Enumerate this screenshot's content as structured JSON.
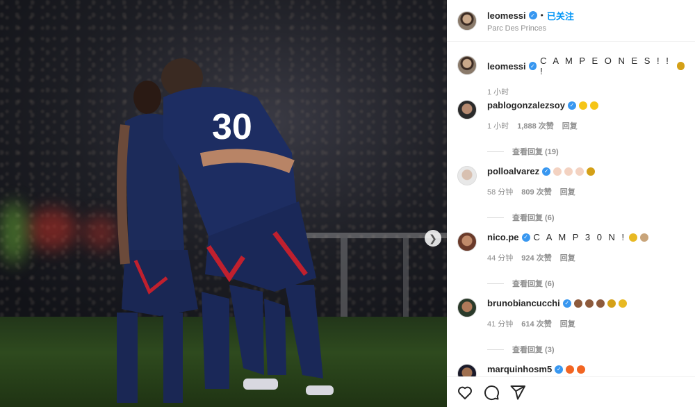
{
  "post": {
    "author": "leomessi",
    "follow_status": "已关注",
    "location": "Parc Des Princes"
  },
  "caption": {
    "author": "leomessi",
    "text": "C A M P E O N E S ! ! !",
    "emojis": [
      "trophy"
    ],
    "time": "1 小时"
  },
  "comments": [
    {
      "user": "pablogonzalezsoy",
      "text": "",
      "emojis": [
        "clap",
        "clap"
      ],
      "time": "1 小时",
      "likes": "1,888 次赞",
      "reply": "回复",
      "view_replies": "查看回复 (19)"
    },
    {
      "user": "polloalvarez",
      "text": "",
      "emojis": [
        "clap-light",
        "clap-light",
        "clap-light",
        "trophy"
      ],
      "time": "58 分钟",
      "likes": "809 次赞",
      "reply": "回复",
      "view_replies": "查看回复 (6)"
    },
    {
      "user": "nico.pe",
      "text": "C A M P 3 0 N !",
      "emojis": [
        "medal",
        "goat"
      ],
      "time": "44 分钟",
      "likes": "924 次赞",
      "reply": "回复",
      "view_replies": "查看回复 (6)"
    },
    {
      "user": "brunobiancucchi",
      "text": "",
      "emojis": [
        "clap-dark",
        "clap-dark",
        "clap-dark",
        "trophy",
        "medal"
      ],
      "time": "41 分钟",
      "likes": "614 次赞",
      "reply": "回复",
      "view_replies": "查看回复 (3)"
    },
    {
      "user": "marquinhosm5",
      "text": "",
      "emojis": [
        "fire",
        "fire"
      ]
    }
  ],
  "colors": {
    "link": "#0095f6",
    "verified": "#3897f0",
    "muted": "#8e8e8e"
  },
  "icons": [
    "heart-icon",
    "comment-icon",
    "share-icon",
    "chevron-right-icon",
    "verified-icon"
  ]
}
